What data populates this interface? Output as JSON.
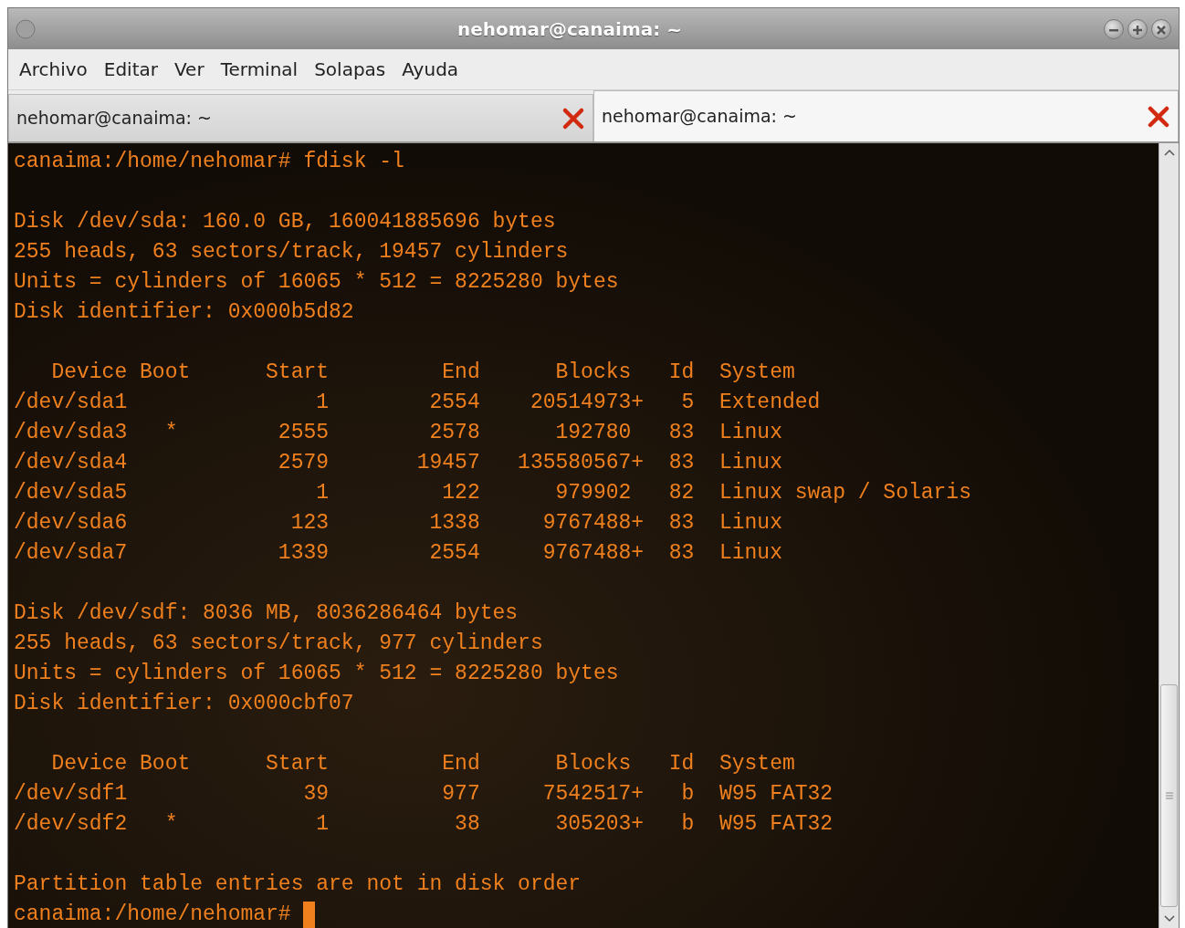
{
  "window": {
    "title": "nehomar@canaima: ~"
  },
  "menu": [
    "Archivo",
    "Editar",
    "Ver",
    "Terminal",
    "Solapas",
    "Ayuda"
  ],
  "tabs": [
    {
      "label": "nehomar@canaima: ~",
      "selected": false
    },
    {
      "label": "nehomar@canaima: ~",
      "selected": true
    }
  ],
  "terminal": {
    "blocks": [
      [
        "canaima:/home/nehomar# fdisk -l"
      ],
      [
        "Disk /dev/sda: 160.0 GB, 160041885696 bytes",
        "255 heads, 63 sectors/track, 19457 cylinders",
        "Units = cylinders of 16065 * 512 = 8225280 bytes",
        "Disk identifier: 0x000b5d82"
      ],
      [
        "   Device Boot      Start         End      Blocks   Id  System",
        "/dev/sda1               1        2554    20514973+   5  Extended",
        "/dev/sda3   *        2555        2578      192780   83  Linux",
        "/dev/sda4            2579       19457   135580567+  83  Linux",
        "/dev/sda5               1         122      979902   82  Linux swap / Solaris",
        "/dev/sda6             123        1338     9767488+  83  Linux",
        "/dev/sda7            1339        2554     9767488+  83  Linux"
      ],
      [
        "Disk /dev/sdf: 8036 MB, 8036286464 bytes",
        "255 heads, 63 sectors/track, 977 cylinders",
        "Units = cylinders of 16065 * 512 = 8225280 bytes",
        "Disk identifier: 0x000cbf07"
      ],
      [
        "   Device Boot      Start         End      Blocks   Id  System",
        "/dev/sdf1              39         977     7542517+   b  W95 FAT32",
        "/dev/sdf2   *           1          38      305203+   b  W95 FAT32"
      ],
      [
        "Partition table entries are not in disk order",
        "canaima:/home/nehomar# "
      ]
    ]
  }
}
